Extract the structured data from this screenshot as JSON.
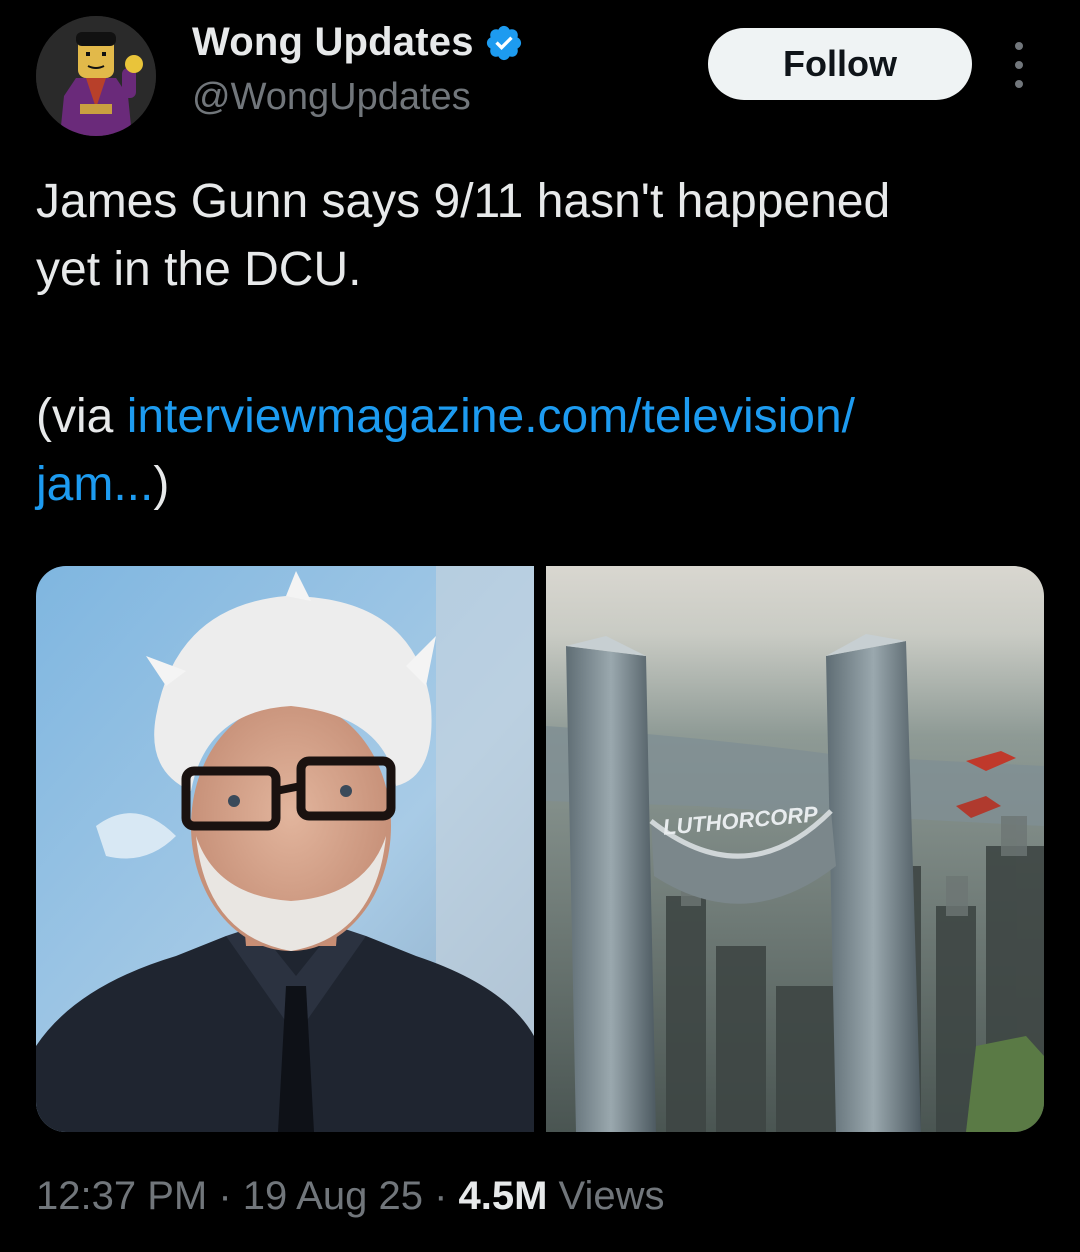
{
  "account": {
    "display_name": "Wong Updates",
    "handle": "@WongUpdates",
    "verified": true,
    "verified_color": "#1d9bf0"
  },
  "actions": {
    "follow_label": "Follow",
    "more_icon": "more-vertical-icon"
  },
  "tweet": {
    "line1": "James Gunn says 9/11 hasn't happened",
    "line2": "yet in the DCU.",
    "via_prefix": "(via ",
    "link_line1": "interviewmagazine.com/television/",
    "link_line2": "jam...",
    "via_suffix": ")",
    "link_color": "#1d9bf0"
  },
  "media": {
    "images": [
      {
        "subject": "portrait-photo"
      },
      {
        "subject": "city-skyline-photo",
        "sign_text": "LUTHORCORP"
      }
    ]
  },
  "meta": {
    "time": "12:37 PM",
    "sep1": " · ",
    "date": "19 Aug 25",
    "sep2": " · ",
    "views_count": "4.5M",
    "views_label": " Views"
  }
}
